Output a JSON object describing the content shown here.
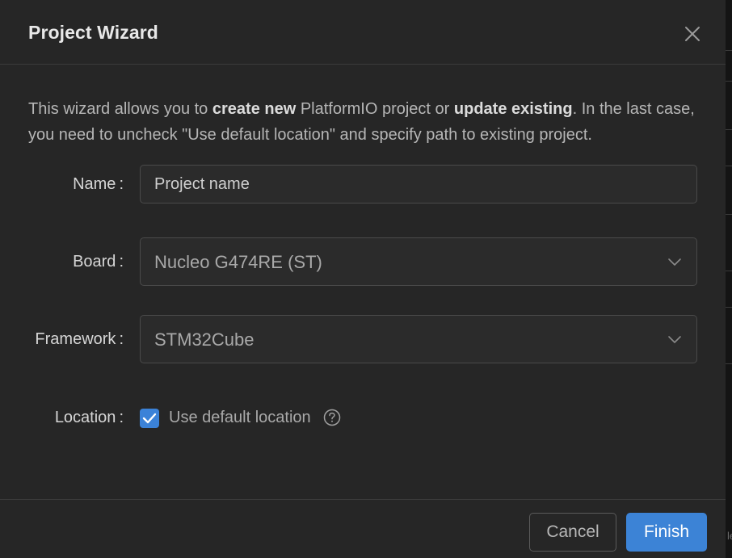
{
  "dialog": {
    "title": "Project Wizard"
  },
  "intro": {
    "part1": "This wizard allows you to ",
    "bold1": "create new",
    "part2": " PlatformIO project or ",
    "bold2": "update existing",
    "part3": ". In the last case, you need to uncheck \"Use default location\" and specify path to existing project."
  },
  "form": {
    "name": {
      "label": "Name",
      "value": "",
      "placeholder": "Project name"
    },
    "board": {
      "label": "Board",
      "selected": "Nucleo G474RE (ST)"
    },
    "framework": {
      "label": "Framework",
      "selected": "STM32Cube"
    },
    "location": {
      "label": "Location",
      "checkbox_label": "Use default location",
      "checked": true
    },
    "colon": ":"
  },
  "footer": {
    "cancel_label": "Cancel",
    "finish_label": "Finish"
  },
  "backdrop": {
    "edge_char": "le"
  },
  "colors": {
    "accent": "#3c83d6",
    "dialog_bg": "#262626",
    "border": "#4a4a4a"
  },
  "icons": {
    "close": "close-icon",
    "chevron": "chevron-down-icon",
    "check": "check-icon",
    "help": "help-circle-icon"
  }
}
